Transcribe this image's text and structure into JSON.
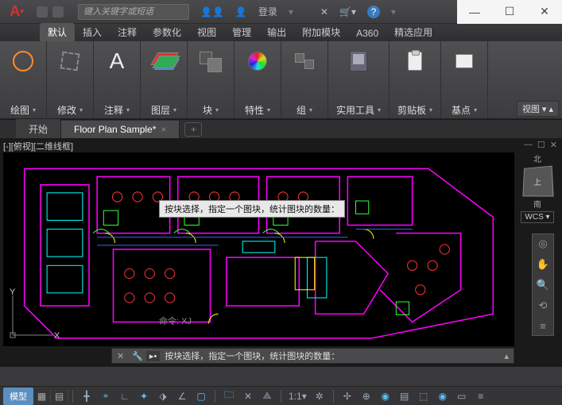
{
  "titlebar": {
    "search_placeholder": "键入关键字或短语",
    "login": "登录",
    "help_tip": "?"
  },
  "win": {
    "min": "—",
    "max": "☐",
    "close": "✕"
  },
  "ribbon_tabs": [
    "默认",
    "插入",
    "注释",
    "参数化",
    "视图",
    "管理",
    "输出",
    "附加模块",
    "A360",
    "精选应用"
  ],
  "panels": {
    "draw": "绘图",
    "modify": "修改",
    "annot": "注释",
    "layer": "图层",
    "block": "块",
    "props": "特性",
    "group": "组",
    "util": "实用工具",
    "clip": "剪贴板",
    "base": "基点"
  },
  "ribbon_view_dd": "视图",
  "file_tabs": {
    "start": "开始",
    "doc": "Floor Plan Sample*",
    "add": "+"
  },
  "viewport_label": "[-][俯视][二维线框]",
  "viewcube": {
    "n": "北",
    "s": "南",
    "face": "上",
    "wcs": "WCS"
  },
  "tooltip": "按块选择，指定一个图块，统计图块的数量：",
  "cmd_inline": "命令: XJ",
  "cmdline": {
    "prefix": "▸•",
    "text": "按块选择，指定一个图块，统计图块的数量："
  },
  "status": {
    "model": "模型",
    "scale": "1:1"
  },
  "ucs": {
    "x": "X",
    "y": "Y"
  }
}
